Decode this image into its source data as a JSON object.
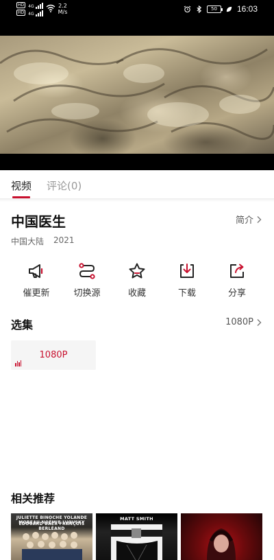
{
  "status_bar": {
    "hd1": "HD",
    "hd2": "HD",
    "network1": "4G",
    "network2": "4G",
    "speed_value": "2.2",
    "speed_unit": "M/s",
    "battery": "50",
    "time": "16:03"
  },
  "tabs": [
    {
      "label": "视频",
      "active": true
    },
    {
      "label": "评论(0)",
      "active": false
    }
  ],
  "show": {
    "title": "中国医生",
    "intro_label": "简介",
    "region": "中国大陆",
    "year": "2021"
  },
  "actions": [
    {
      "label": "催更新",
      "icon": "megaphone-icon"
    },
    {
      "label": "切换源",
      "icon": "switch-source-icon"
    },
    {
      "label": "收藏",
      "icon": "star-icon"
    },
    {
      "label": "下载",
      "icon": "download-icon"
    },
    {
      "label": "分享",
      "icon": "share-icon"
    }
  ],
  "episodes": {
    "title": "选集",
    "quality": "1080P",
    "items": [
      {
        "label": "1080P",
        "playing": true
      }
    ]
  },
  "recommendations": {
    "title": "相关推荐",
    "posters": [
      {
        "top_text": "JULIETTE BINOCHE  YOLANDE MOREAU  NOÉMIE LVOVSKY",
        "sub_text": "ÉDOUARD BAER  FRANÇOIS BERLÉAND"
      },
      {
        "top_text": "MATT SMITH"
      },
      {
        "top_text": ""
      }
    ]
  },
  "colors": {
    "accent": "#c8102e",
    "status_bar_bg": "#000000"
  }
}
